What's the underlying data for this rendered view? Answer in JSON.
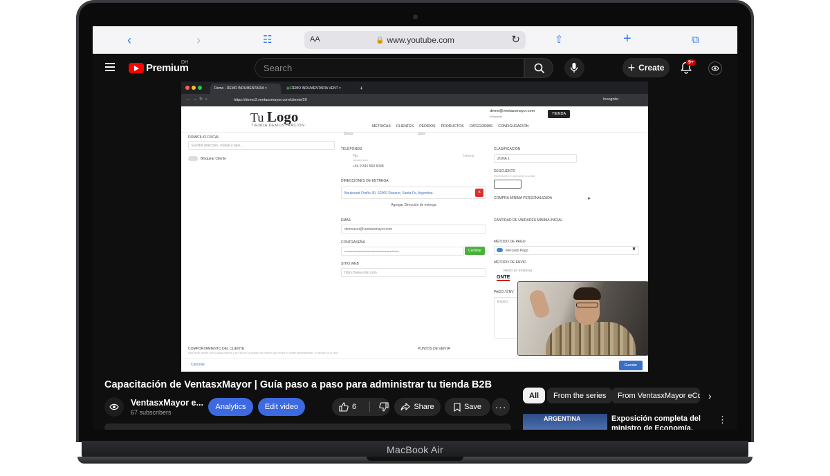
{
  "device": {
    "label": "MacBook Air"
  },
  "safari": {
    "url": "www.youtube.com",
    "text_size": "AA"
  },
  "youtube": {
    "logo_text": "Premium",
    "region": "DH",
    "search_placeholder": "Search",
    "create_label": "Create",
    "notification_count": "9+"
  },
  "recorded_screen": {
    "tabs": [
      {
        "label": "Demo - DEMO INDUMENTARIA"
      },
      {
        "label": "DEMO INDUMENTARIA VENT"
      }
    ],
    "address": "https://demo3.ventasxmayor.com/cliente/20",
    "incognito_label": "Incognito",
    "logo_main": "Tu",
    "logo_bold": "Logo",
    "logo_subtitle": "TIENDA DEMOSTRACIÓN",
    "account_email": "demo@ventasxmayor.com",
    "account_sub": "#Sincasar",
    "store_button": "TIENDA",
    "nav": [
      "MÉTRICAS",
      "CLIENTES",
      "PEDIDOS",
      "PRODUCTOS",
      "CATEGORÍAS",
      "CONFIGURACIÓN"
    ],
    "left": {
      "fiscal_label": "DOMICILIO FISCAL",
      "fiscal_placeholder": "Escribir dirección, ciudad y país...",
      "block_label": "Bloquear Cliente"
    },
    "middle": {
      "top_value": "Demo",
      "top_value_2": "User",
      "phones_label": "TELÉFONOS",
      "phone_type": "Fijo",
      "phone_sub": "Característica",
      "phone_number": "+54 9 341 569 5048",
      "phone_type_2": "Interno",
      "delivery_label": "DIRECCIONES DE ENTREGA",
      "delivery_address": "Boulevard Oroño 40, S2000 Rosario, Santa Fe, Argentina",
      "add_delivery": "Agregar Dirección de entrega",
      "email_label": "EMAIL",
      "email_value": "demouser@ventasxmayor.com",
      "password_label": "CONTRASEÑA",
      "password_value": "••••••••••••••••••••••••••••••••••••••••••••••••••••••••",
      "password_button": "Cambiar",
      "website_label": "SITIO WEB",
      "website_placeholder": "https://www.sitio.com"
    },
    "right": {
      "class_label": "CLASIFICACIÓN",
      "class_value": "ZONA 1",
      "discount_label": "DESCUENTO",
      "discount_sub": "(Sobrescribe el global de la zona)",
      "min_purchase_label": "COMPRA MÍNIMA PERSONALIZADA",
      "min_units_label": "CANTIDAD DE UNIDADES MÍNIMA INICIAL",
      "payment_label": "MÉTODO DE PAGO",
      "payment_value": "Mercado Pago",
      "shipping_label": "MÉTODO DE ENVÍO",
      "shipping_value": "Retiro en empresa",
      "shipping_logo": "ONTE",
      "pay_on_label": "PAGO / ENV",
      "notes_placeholder": "Especi"
    },
    "bottom": {
      "behavior_label": "COMPORTAMIENTO DEL CLIENTE",
      "pos_label": "PUNTOS DE VENTA",
      "behavior_note": "Este texto servirá como ayuda interna y se verá en la gestión de compra que recibe tu centro administrador. Tu cliente no lo verá.",
      "cancel": "Cancelar",
      "save": "Guardar"
    }
  },
  "video": {
    "title": "Capacitación de VentasxMayor | Guía paso a paso para administrar tu tienda B2B",
    "channel_name": "VentasxMayor e...",
    "subscribers": "67 subscribers",
    "analytics_label": "Analytics",
    "edit_label": "Edit video",
    "likes": "6",
    "share_label": "Share",
    "save_label": "Save"
  },
  "sidebar": {
    "chips": [
      "All",
      "From the series",
      "From VentasxMayor eCom"
    ],
    "reco": {
      "thumb_text": "ARGENTINA",
      "title": "Exposición completa del ministro de Economía, Luis"
    }
  }
}
